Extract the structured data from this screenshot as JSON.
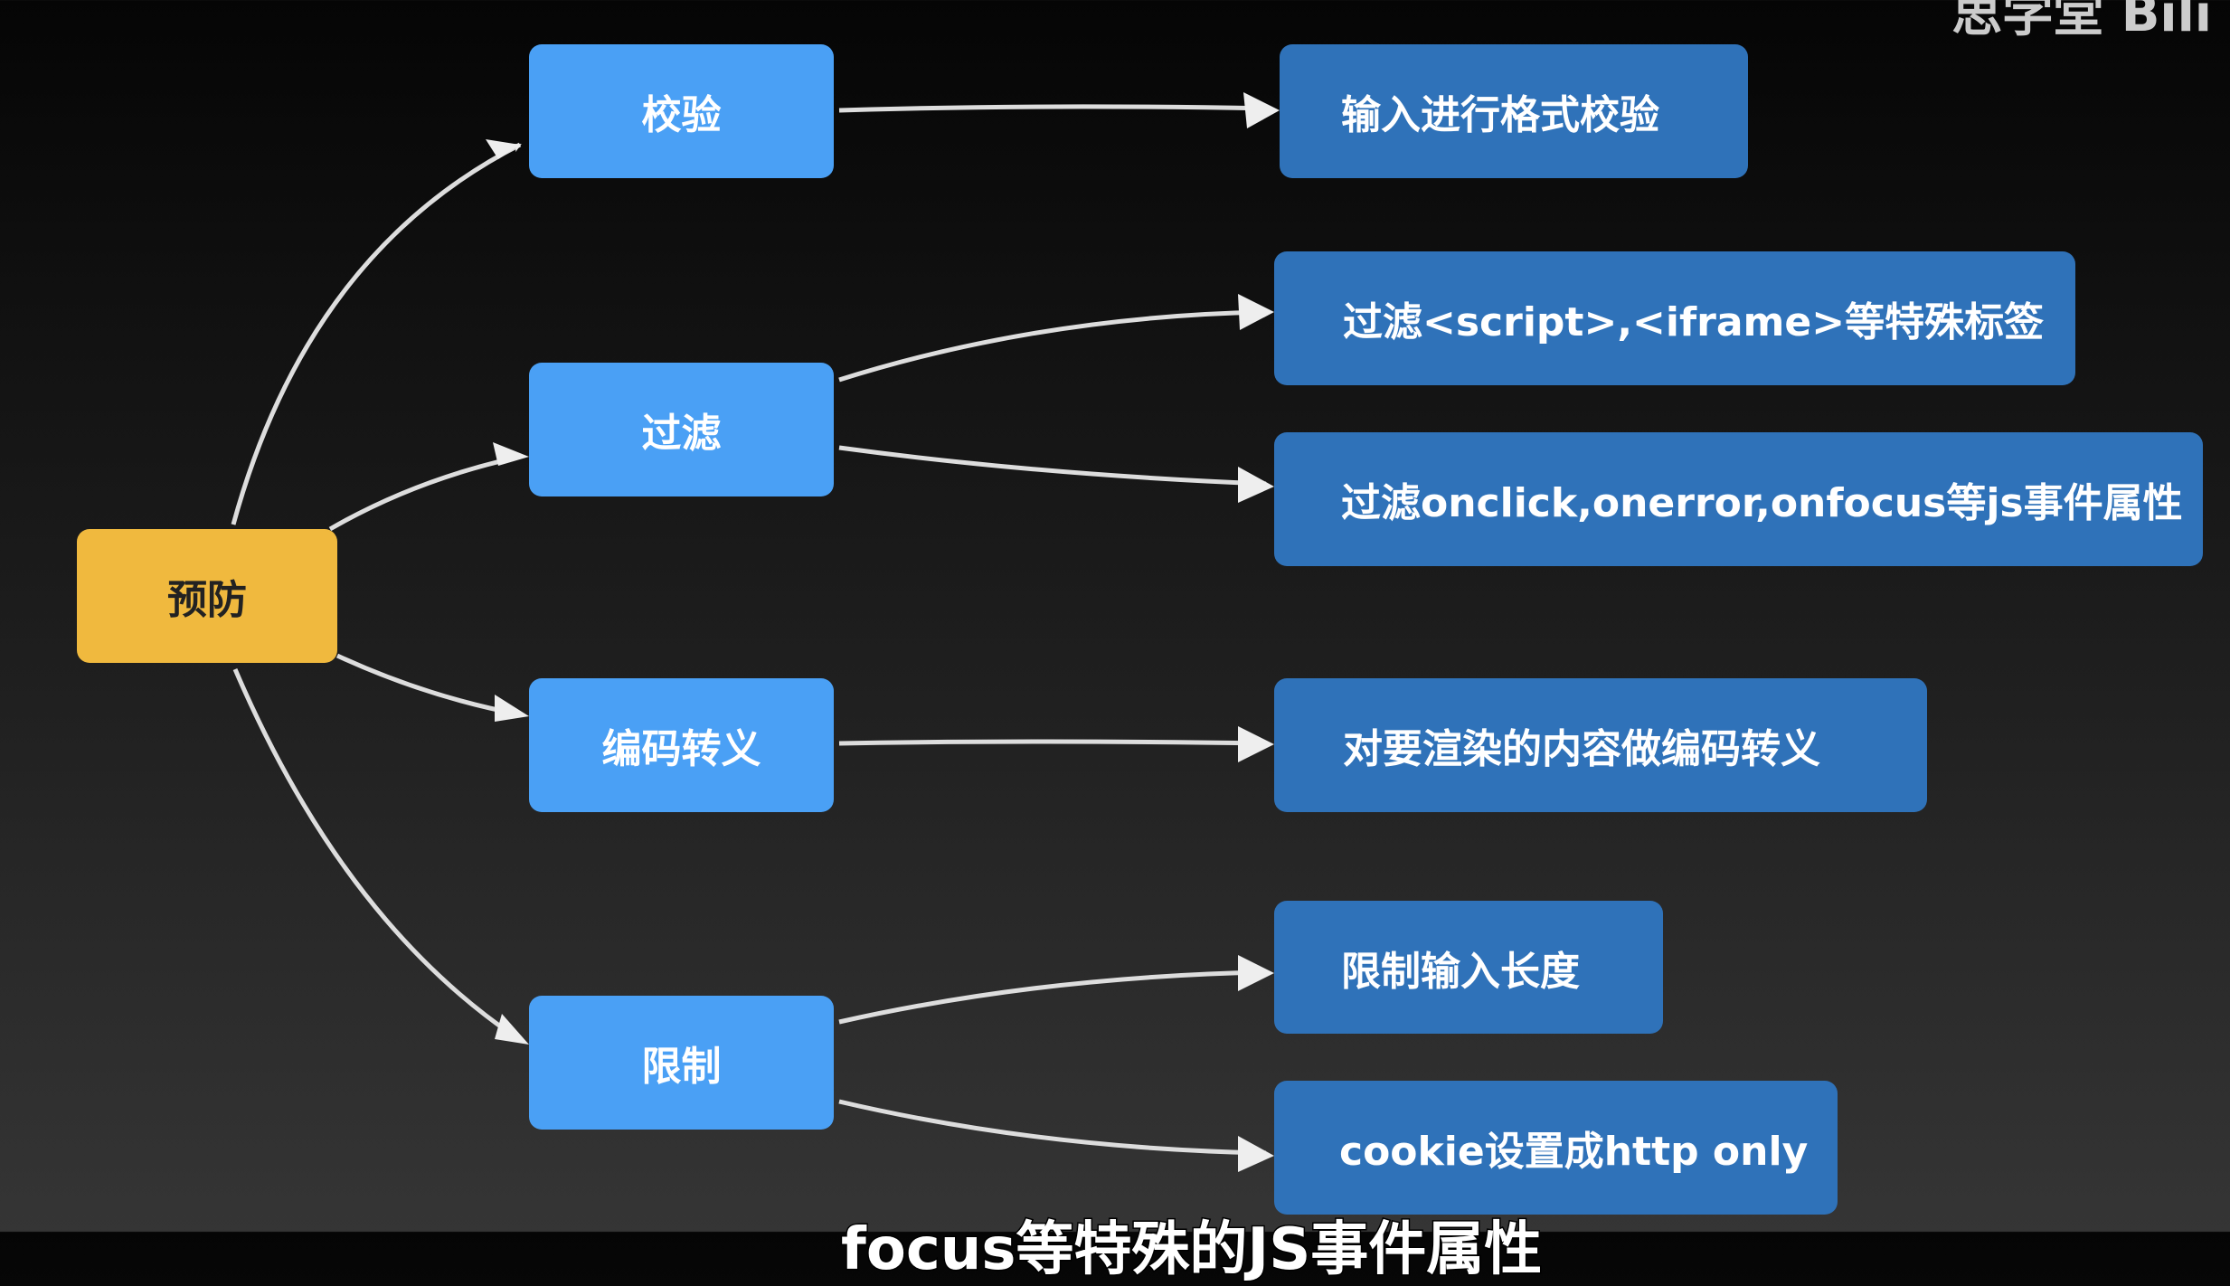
{
  "watermark": "思学堂 Bili",
  "root": "预防",
  "branches": [
    {
      "label": "校验",
      "children": [
        "输入进行格式校验"
      ]
    },
    {
      "label": "过滤",
      "children": [
        "过滤<script>,<iframe>等特殊标签",
        "过滤onclick,onerror,onfocus等js事件属性"
      ]
    },
    {
      "label": "编码转义",
      "children": [
        "对要渲染的内容做编码转义"
      ]
    },
    {
      "label": "限制",
      "children": [
        "限制输入长度",
        "cookie设置成http only"
      ]
    }
  ],
  "subtitle": "focus等特殊的JS事件属性",
  "colors": {
    "root": "#f0b93e",
    "branch": "#4aa0f5",
    "leaf": "#2f72b9"
  }
}
